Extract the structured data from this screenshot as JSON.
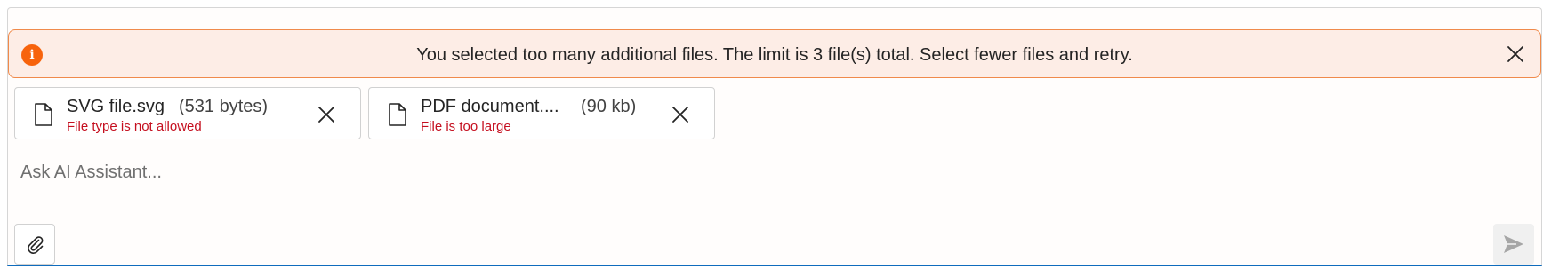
{
  "composer": {
    "alert": {
      "icon": "info-icon",
      "icon_glyph": "i",
      "message": "You selected too many additional files. The limit is 3 file(s) total. Select fewer files and retry.",
      "close_icon": "close-icon",
      "accent_color": "#f7630c"
    },
    "attachments": [
      {
        "icon": "file-icon",
        "name": "SVG file.svg",
        "size": "(531 bytes)",
        "error": "File type is not allowed",
        "remove_icon": "close-icon"
      },
      {
        "icon": "file-icon",
        "name": "PDF document....",
        "size": "(90 kb)",
        "error": "File is too large",
        "remove_icon": "close-icon"
      }
    ],
    "input": {
      "placeholder": "Ask AI Assistant...",
      "value": ""
    },
    "attach_button": {
      "icon": "paperclip-icon"
    },
    "send_button": {
      "icon": "send-icon",
      "state": "disabled"
    },
    "colors": {
      "error_text": "#c50f1f",
      "focus_border": "#0f6cbd",
      "alert_background": "#fdede6",
      "alert_border": "#f08a4b"
    }
  }
}
